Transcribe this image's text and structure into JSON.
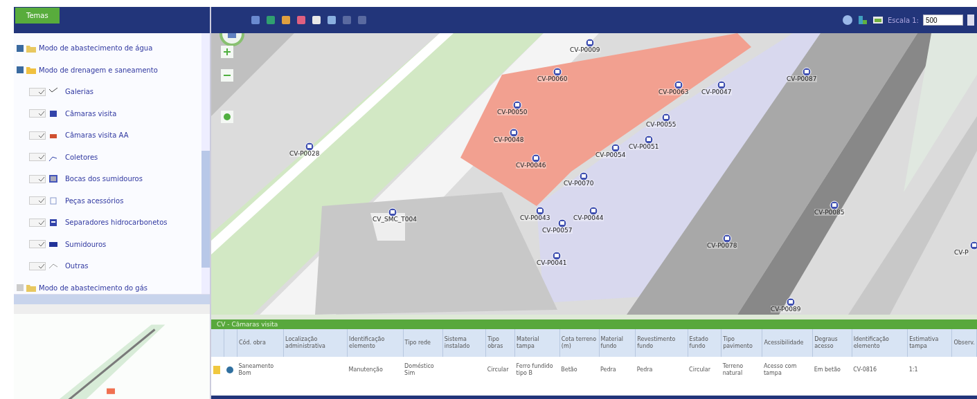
{
  "sidebar": {
    "tab": {
      "label": "Temas",
      "selected": true
    },
    "tree": [
      {
        "label": "Modo de abastecimento de água",
        "checked": true,
        "expanded": false
      },
      {
        "label": "Modo de drenagem e saneamento",
        "checked": true,
        "expanded": true,
        "children": [
          {
            "label": "Galerias",
            "checked": true
          },
          {
            "label": "Câmaras visita",
            "checked": true
          },
          {
            "label": "Câmaras visita AA",
            "checked": true
          },
          {
            "label": "Coletores",
            "checked": true
          },
          {
            "label": "Bocas dos sumidouros",
            "checked": true
          },
          {
            "label": "Peças acessórios",
            "checked": true
          },
          {
            "label": "Separadores hidrocarbonetos",
            "checked": true
          },
          {
            "label": "Sumidouros",
            "checked": true
          },
          {
            "label": "Outras",
            "checked": true
          }
        ]
      },
      {
        "label": "Modo de abastecimento do gás",
        "checked": false,
        "expanded": false
      }
    ]
  },
  "toolbar": {
    "scale_label": "Escala 1:",
    "scale_value": "500"
  },
  "map": {
    "markers": [
      {
        "label": "CV-P0009"
      },
      {
        "label": "CV-P0060"
      },
      {
        "label": "CV-P0087"
      },
      {
        "label": "CV-P0063"
      },
      {
        "label": "CV-P0047"
      },
      {
        "label": "CV-P0050"
      },
      {
        "label": "CV-P0055"
      },
      {
        "label": "CV-P0048"
      },
      {
        "label": "CV-P0051"
      },
      {
        "label": "CV-P0054"
      },
      {
        "label": "CV-P0046"
      },
      {
        "label": "CV-P0070"
      },
      {
        "label": "CV-P0028"
      },
      {
        "label": "CV_SMC_T004"
      },
      {
        "label": "CV-P0043"
      },
      {
        "label": "CV-P0044"
      },
      {
        "label": "CV-P0057"
      },
      {
        "label": "CV-P0085"
      },
      {
        "label": "CV-P0078"
      },
      {
        "label": "CV-P0041"
      },
      {
        "label": "CV-P0089"
      },
      {
        "label": "CV-P"
      }
    ]
  },
  "table": {
    "title": "CV - Câmaras visita",
    "columns": [
      "Cód. obra",
      "Localização administrativa",
      "Identificação elemento",
      "Tipo rede",
      "Sistema instalado",
      "Tipo obras",
      "Material tampa",
      "Cota terreno (m)",
      "Material fundo",
      "Revestimento fundo",
      "Estado fundo",
      "Tipo pavimento",
      "Acessibilidade",
      "Degraus acesso",
      "Identificação elemento",
      "Estimativa tampa",
      "Observ."
    ],
    "rows": [
      {
        "selected": false,
        "cells": [
          "Saneamento Bom",
          "",
          "Manutenção",
          "Doméstico Sim",
          "",
          "Circular",
          "Ferro fundido tipo B",
          "Betão",
          "Pedra",
          "Pedra",
          "Circular",
          "Terreno natural",
          "Acesso com tampa",
          "Em betão",
          "CV-0816",
          "1:1",
          ""
        ]
      }
    ]
  }
}
